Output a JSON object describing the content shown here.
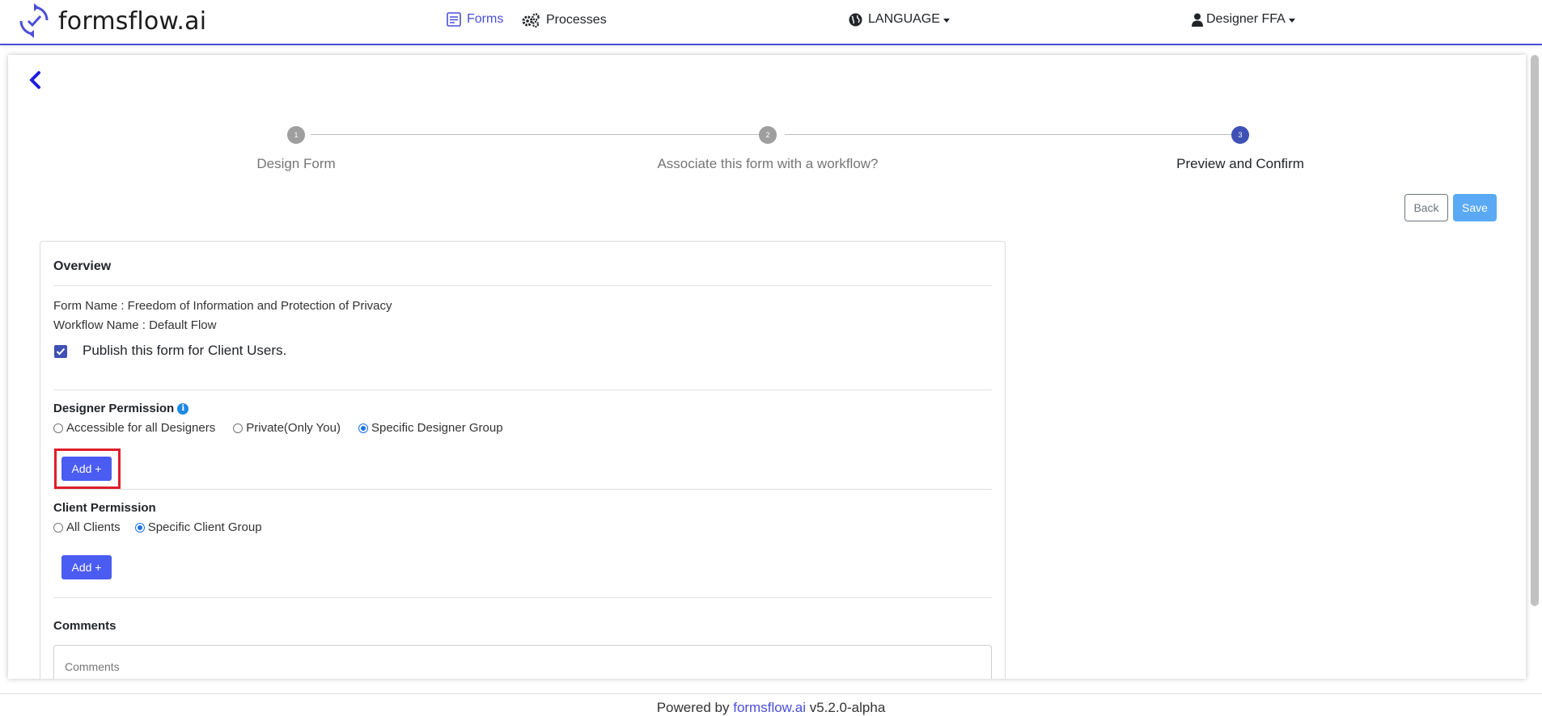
{
  "brand": {
    "name": "formsflow.ai"
  },
  "nav": {
    "forms": "Forms",
    "processes": "Processes",
    "language": "LANGUAGE",
    "user": "Designer FFA"
  },
  "stepper": {
    "steps": [
      {
        "number": "1",
        "label": "Design Form"
      },
      {
        "number": "2",
        "label": "Associate this form with a workflow?"
      },
      {
        "number": "3",
        "label": "Preview and Confirm"
      }
    ],
    "active_step": 3
  },
  "actions": {
    "back": "Back",
    "save": "Save"
  },
  "overview": {
    "title": "Overview",
    "form_name": "Form Name : Freedom of Information and Protection of Privacy",
    "workflow_name": "Workflow Name : Default Flow",
    "publish_label": "Publish this form for Client Users.",
    "publish_checked": true
  },
  "designer_permission": {
    "title": "Designer Permission",
    "options": [
      "Accessible for all Designers",
      "Private(Only You)",
      "Specific Designer Group"
    ],
    "selected": "Specific Designer Group",
    "add_label": "Add +"
  },
  "client_permission": {
    "title": "Client Permission",
    "options": [
      "All Clients",
      "Specific Client Group"
    ],
    "selected": "Specific Client Group",
    "add_label": "Add +"
  },
  "comments": {
    "title": "Comments",
    "placeholder": "Comments"
  },
  "footer": {
    "prefix": "Powered by",
    "link": "formsflow.ai",
    "version": "v5.2.0-alpha"
  },
  "colors": {
    "accent": "#4a4fd8",
    "primary_button": "#4a5cf2",
    "save_button": "#5aa9f5",
    "highlight": "#e01e2b"
  }
}
